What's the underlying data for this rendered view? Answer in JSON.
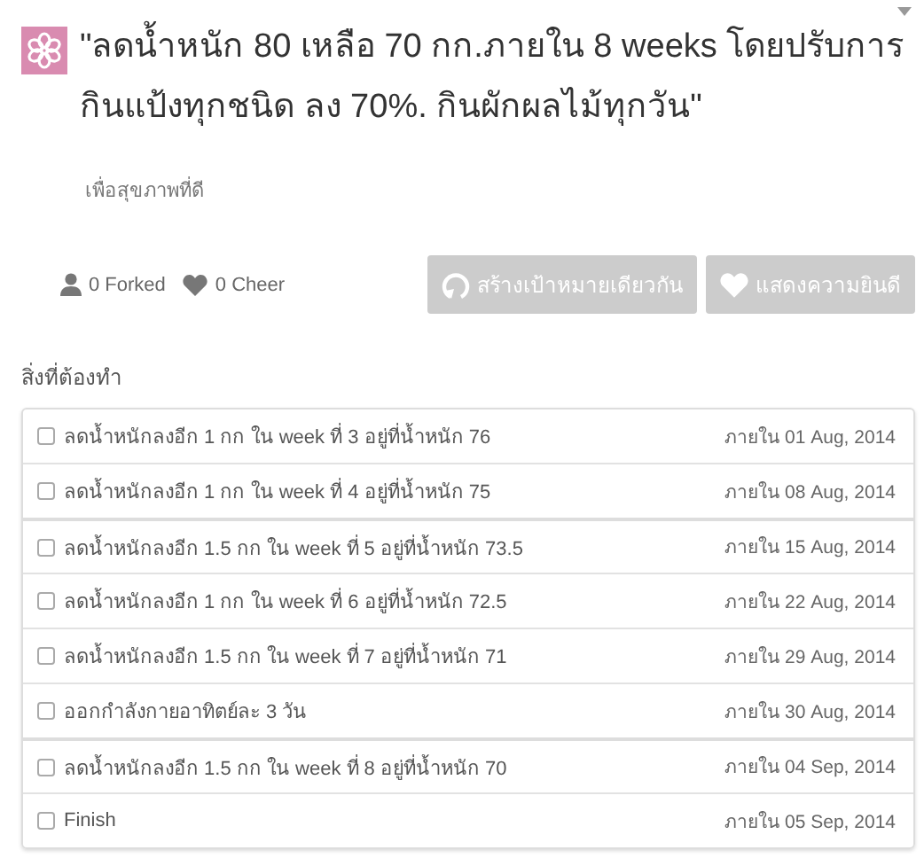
{
  "goal": {
    "title": "\"ลดน้ำหนัก 80 เหลือ 70 กก.ภายใน 8 weeks โดยปรับการกินแป้งทุกชนิด ลง 70%. กินผักผลไม้ทุกวัน\"",
    "subtitle": "เพื่อสุขภาพที่ดี"
  },
  "stats": {
    "forked": "0 Forked",
    "cheer": "0 Cheer"
  },
  "buttons": [
    {
      "kind": "fork",
      "label": "สร้างเป้าหมายเดียวกัน"
    },
    {
      "kind": "cheer",
      "label": "แสดงความยินดี"
    }
  ],
  "todo": {
    "heading": "สิ่งที่ต้องทำ",
    "items": [
      {
        "text": "ลดน้ำหนักลงอีก 1 กก ใน week ที่ 3 อยู่ที่น้ำหนัก 76",
        "due": "ภายใน 01 Aug, 2014",
        "checked": false
      },
      {
        "text": "ลดน้ำหนักลงอีก 1 กก ใน week ที่ 4 อยู่ที่น้ำหนัก 75",
        "due": "ภายใน 08 Aug, 2014",
        "checked": false
      },
      {
        "text": "ลดน้ำหนักลงอีก 1.5 กก ใน week ที่ 5 อยู่ที่น้ำหนัก 73.5",
        "due": "ภายใน 15 Aug, 2014",
        "checked": false
      },
      {
        "text": "ลดน้ำหนักลงอีก 1 กก ใน week ที่ 6 อยู่ที่น้ำหนัก 72.5",
        "due": "ภายใน 22 Aug, 2014",
        "checked": false
      },
      {
        "text": "ลดน้ำหนักลงอีก 1.5 กก ใน week ที่ 7 อยู่ที่น้ำหนัก 71",
        "due": "ภายใน 29 Aug, 2014",
        "checked": false
      },
      {
        "text": "ออกกำลังกายอาทิตย์ละ 3 วัน",
        "due": "ภายใน 30 Aug, 2014",
        "checked": false
      },
      {
        "text": "ลดน้ำหนักลงอีก 1.5 กก ใน week ที่ 8 อยู่ที่น้ำหนัก 70",
        "due": "ภายใน 04 Sep, 2014",
        "checked": false
      },
      {
        "text": "Finish",
        "due": "ภายใน 05 Sep, 2014",
        "checked": false
      }
    ]
  }
}
